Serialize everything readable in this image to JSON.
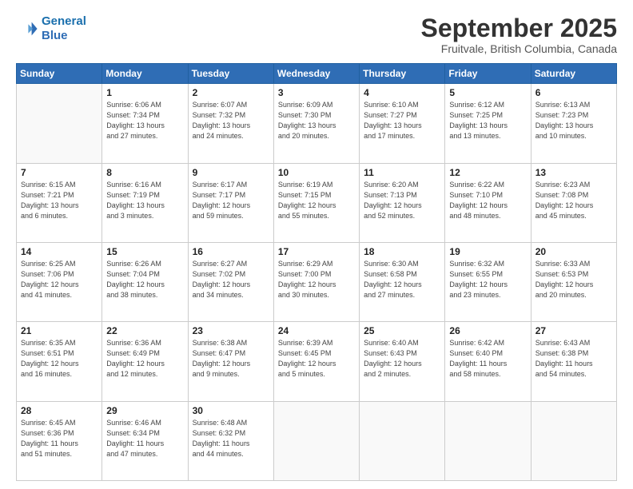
{
  "header": {
    "logo_line1": "General",
    "logo_line2": "Blue",
    "month": "September 2025",
    "location": "Fruitvale, British Columbia, Canada"
  },
  "weekdays": [
    "Sunday",
    "Monday",
    "Tuesday",
    "Wednesday",
    "Thursday",
    "Friday",
    "Saturday"
  ],
  "weeks": [
    [
      {
        "day": "",
        "info": ""
      },
      {
        "day": "1",
        "info": "Sunrise: 6:06 AM\nSunset: 7:34 PM\nDaylight: 13 hours\nand 27 minutes."
      },
      {
        "day": "2",
        "info": "Sunrise: 6:07 AM\nSunset: 7:32 PM\nDaylight: 13 hours\nand 24 minutes."
      },
      {
        "day": "3",
        "info": "Sunrise: 6:09 AM\nSunset: 7:30 PM\nDaylight: 13 hours\nand 20 minutes."
      },
      {
        "day": "4",
        "info": "Sunrise: 6:10 AM\nSunset: 7:27 PM\nDaylight: 13 hours\nand 17 minutes."
      },
      {
        "day": "5",
        "info": "Sunrise: 6:12 AM\nSunset: 7:25 PM\nDaylight: 13 hours\nand 13 minutes."
      },
      {
        "day": "6",
        "info": "Sunrise: 6:13 AM\nSunset: 7:23 PM\nDaylight: 13 hours\nand 10 minutes."
      }
    ],
    [
      {
        "day": "7",
        "info": "Sunrise: 6:15 AM\nSunset: 7:21 PM\nDaylight: 13 hours\nand 6 minutes."
      },
      {
        "day": "8",
        "info": "Sunrise: 6:16 AM\nSunset: 7:19 PM\nDaylight: 13 hours\nand 3 minutes."
      },
      {
        "day": "9",
        "info": "Sunrise: 6:17 AM\nSunset: 7:17 PM\nDaylight: 12 hours\nand 59 minutes."
      },
      {
        "day": "10",
        "info": "Sunrise: 6:19 AM\nSunset: 7:15 PM\nDaylight: 12 hours\nand 55 minutes."
      },
      {
        "day": "11",
        "info": "Sunrise: 6:20 AM\nSunset: 7:13 PM\nDaylight: 12 hours\nand 52 minutes."
      },
      {
        "day": "12",
        "info": "Sunrise: 6:22 AM\nSunset: 7:10 PM\nDaylight: 12 hours\nand 48 minutes."
      },
      {
        "day": "13",
        "info": "Sunrise: 6:23 AM\nSunset: 7:08 PM\nDaylight: 12 hours\nand 45 minutes."
      }
    ],
    [
      {
        "day": "14",
        "info": "Sunrise: 6:25 AM\nSunset: 7:06 PM\nDaylight: 12 hours\nand 41 minutes."
      },
      {
        "day": "15",
        "info": "Sunrise: 6:26 AM\nSunset: 7:04 PM\nDaylight: 12 hours\nand 38 minutes."
      },
      {
        "day": "16",
        "info": "Sunrise: 6:27 AM\nSunset: 7:02 PM\nDaylight: 12 hours\nand 34 minutes."
      },
      {
        "day": "17",
        "info": "Sunrise: 6:29 AM\nSunset: 7:00 PM\nDaylight: 12 hours\nand 30 minutes."
      },
      {
        "day": "18",
        "info": "Sunrise: 6:30 AM\nSunset: 6:58 PM\nDaylight: 12 hours\nand 27 minutes."
      },
      {
        "day": "19",
        "info": "Sunrise: 6:32 AM\nSunset: 6:55 PM\nDaylight: 12 hours\nand 23 minutes."
      },
      {
        "day": "20",
        "info": "Sunrise: 6:33 AM\nSunset: 6:53 PM\nDaylight: 12 hours\nand 20 minutes."
      }
    ],
    [
      {
        "day": "21",
        "info": "Sunrise: 6:35 AM\nSunset: 6:51 PM\nDaylight: 12 hours\nand 16 minutes."
      },
      {
        "day": "22",
        "info": "Sunrise: 6:36 AM\nSunset: 6:49 PM\nDaylight: 12 hours\nand 12 minutes."
      },
      {
        "day": "23",
        "info": "Sunrise: 6:38 AM\nSunset: 6:47 PM\nDaylight: 12 hours\nand 9 minutes."
      },
      {
        "day": "24",
        "info": "Sunrise: 6:39 AM\nSunset: 6:45 PM\nDaylight: 12 hours\nand 5 minutes."
      },
      {
        "day": "25",
        "info": "Sunrise: 6:40 AM\nSunset: 6:43 PM\nDaylight: 12 hours\nand 2 minutes."
      },
      {
        "day": "26",
        "info": "Sunrise: 6:42 AM\nSunset: 6:40 PM\nDaylight: 11 hours\nand 58 minutes."
      },
      {
        "day": "27",
        "info": "Sunrise: 6:43 AM\nSunset: 6:38 PM\nDaylight: 11 hours\nand 54 minutes."
      }
    ],
    [
      {
        "day": "28",
        "info": "Sunrise: 6:45 AM\nSunset: 6:36 PM\nDaylight: 11 hours\nand 51 minutes."
      },
      {
        "day": "29",
        "info": "Sunrise: 6:46 AM\nSunset: 6:34 PM\nDaylight: 11 hours\nand 47 minutes."
      },
      {
        "day": "30",
        "info": "Sunrise: 6:48 AM\nSunset: 6:32 PM\nDaylight: 11 hours\nand 44 minutes."
      },
      {
        "day": "",
        "info": ""
      },
      {
        "day": "",
        "info": ""
      },
      {
        "day": "",
        "info": ""
      },
      {
        "day": "",
        "info": ""
      }
    ]
  ]
}
